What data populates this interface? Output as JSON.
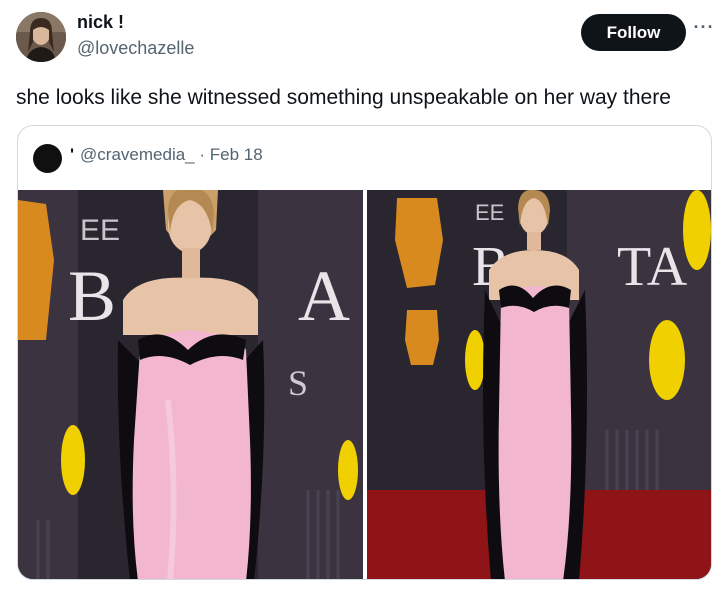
{
  "author": {
    "display_name": "nick !",
    "handle": "@lovechazelle",
    "avatar_icon": "profile-photo"
  },
  "actions": {
    "follow_label": "Follow",
    "more_label": "···"
  },
  "tweet": {
    "text": "she looks like she witnessed something unspeakable on her way there"
  },
  "quoted_tweet": {
    "display_name": "'",
    "handle": "@cravemedia_",
    "date": "· Feb 18",
    "photos": [
      {
        "alt": "Woman in a pink strapless gown with black sleeves at the BAFTA red carpet",
        "backdrop_text": "EE BAFTA"
      },
      {
        "alt": "Full-length view of the pink and black gown on the red carpet",
        "backdrop_text": "EE BAFTA"
      }
    ]
  },
  "colors": {
    "text_primary": "#0f1419",
    "text_secondary": "#536471",
    "border": "#cfd9de",
    "button_bg": "#0f1419",
    "gown_pink": "#f2b6cf",
    "backdrop_dark": "#2a2630",
    "bafta_gold": "#d98a1e",
    "carpet_red": "#8e1418"
  }
}
